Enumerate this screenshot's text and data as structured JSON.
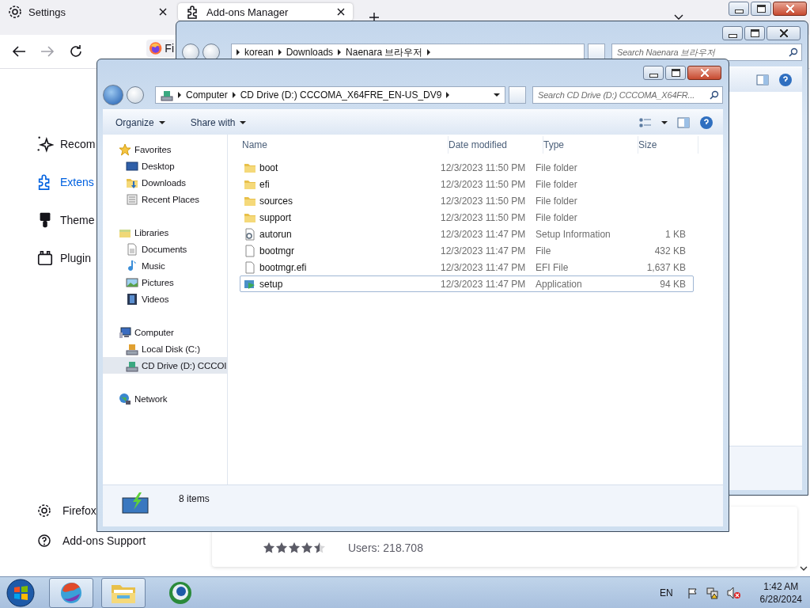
{
  "browser": {
    "tabs": [
      {
        "label": "Settings",
        "selected": false
      },
      {
        "label": "Add-ons Manager",
        "selected": true
      }
    ],
    "address_text": "Fi",
    "categories": [
      {
        "label": "Recom",
        "selected": false
      },
      {
        "label": "Extens",
        "selected": true
      },
      {
        "label": "Theme",
        "selected": false
      },
      {
        "label": "Plugin",
        "selected": false
      }
    ],
    "footer_links": [
      "Firefox",
      "Add-ons Support"
    ],
    "addon": {
      "stars": 4.5,
      "users": "Users: 218.708"
    }
  },
  "back_window": {
    "breadcrumbs": [
      "korean",
      "Downloads",
      "Naenara 브라우저"
    ],
    "search": {
      "placeholder": "Search Naenara 브라우저"
    }
  },
  "explorer": {
    "breadcrumbs": [
      "Computer",
      "CD Drive (D:) CCCOMA_X64FRE_EN-US_DV9"
    ],
    "search": {
      "placeholder": "Search CD Drive (D:) CCCOMA_X64FR..."
    },
    "toolbar": [
      "Organize",
      "Share with"
    ],
    "nav": [
      {
        "label": "Favorites",
        "kind": "star",
        "selected": false,
        "children": [
          {
            "label": "Desktop",
            "kind": "desktop",
            "selected": false
          },
          {
            "label": "Downloads",
            "kind": "downloads",
            "selected": false
          },
          {
            "label": "Recent Places",
            "kind": "recent",
            "selected": false
          }
        ]
      },
      {
        "label": "Libraries",
        "kind": "library",
        "selected": false,
        "children": [
          {
            "label": "Documents",
            "kind": "document",
            "selected": false
          },
          {
            "label": "Music",
            "kind": "music",
            "selected": false
          },
          {
            "label": "Pictures",
            "kind": "pictures",
            "selected": false
          },
          {
            "label": "Videos",
            "kind": "videos",
            "selected": false
          }
        ]
      },
      {
        "label": "Computer",
        "kind": "computer",
        "selected": false,
        "children": [
          {
            "label": "Local Disk (C:)",
            "kind": "disk",
            "selected": false
          },
          {
            "label": "CD Drive (D:) CCCOI",
            "kind": "cd",
            "selected": true
          }
        ]
      },
      {
        "label": "Network",
        "kind": "network",
        "selected": false
      }
    ],
    "columns": [
      "Name",
      "Date modified",
      "Type",
      "Size"
    ],
    "files": [
      {
        "name": "boot",
        "date": "12/3/2023 11:50 PM",
        "type": "File folder",
        "kind": "folder",
        "focused": false
      },
      {
        "name": "efi",
        "date": "12/3/2023 11:50 PM",
        "type": "File folder",
        "kind": "folder",
        "focused": false
      },
      {
        "name": "sources",
        "date": "12/3/2023 11:50 PM",
        "type": "File folder",
        "kind": "folder",
        "focused": false
      },
      {
        "name": "support",
        "date": "12/3/2023 11:50 PM",
        "type": "File folder",
        "kind": "folder",
        "focused": false
      },
      {
        "name": "autorun",
        "date": "12/3/2023 11:47 PM",
        "type": "Setup Information",
        "size": "1 KB",
        "kind": "inf",
        "focused": false
      },
      {
        "name": "bootmgr",
        "date": "12/3/2023 11:47 PM",
        "type": "File",
        "size": "432 KB",
        "kind": "file",
        "focused": false
      },
      {
        "name": "bootmgr.efi",
        "date": "12/3/2023 11:47 PM",
        "type": "EFI File",
        "size": "1,637 KB",
        "kind": "file",
        "focused": false
      },
      {
        "name": "setup",
        "date": "12/3/2023 11:47 PM",
        "type": "Application",
        "size": "94 KB",
        "kind": "app",
        "focused": true
      }
    ],
    "status": "8 items"
  },
  "taskbar": {
    "buttons": [
      {
        "kind": "start",
        "active": false
      },
      {
        "kind": "browser",
        "active": true
      },
      {
        "kind": "explorer",
        "active": true
      },
      {
        "kind": "globe",
        "active": false
      }
    ],
    "language": "EN",
    "time": "1:42 AM",
    "date": "6/28/2024"
  }
}
